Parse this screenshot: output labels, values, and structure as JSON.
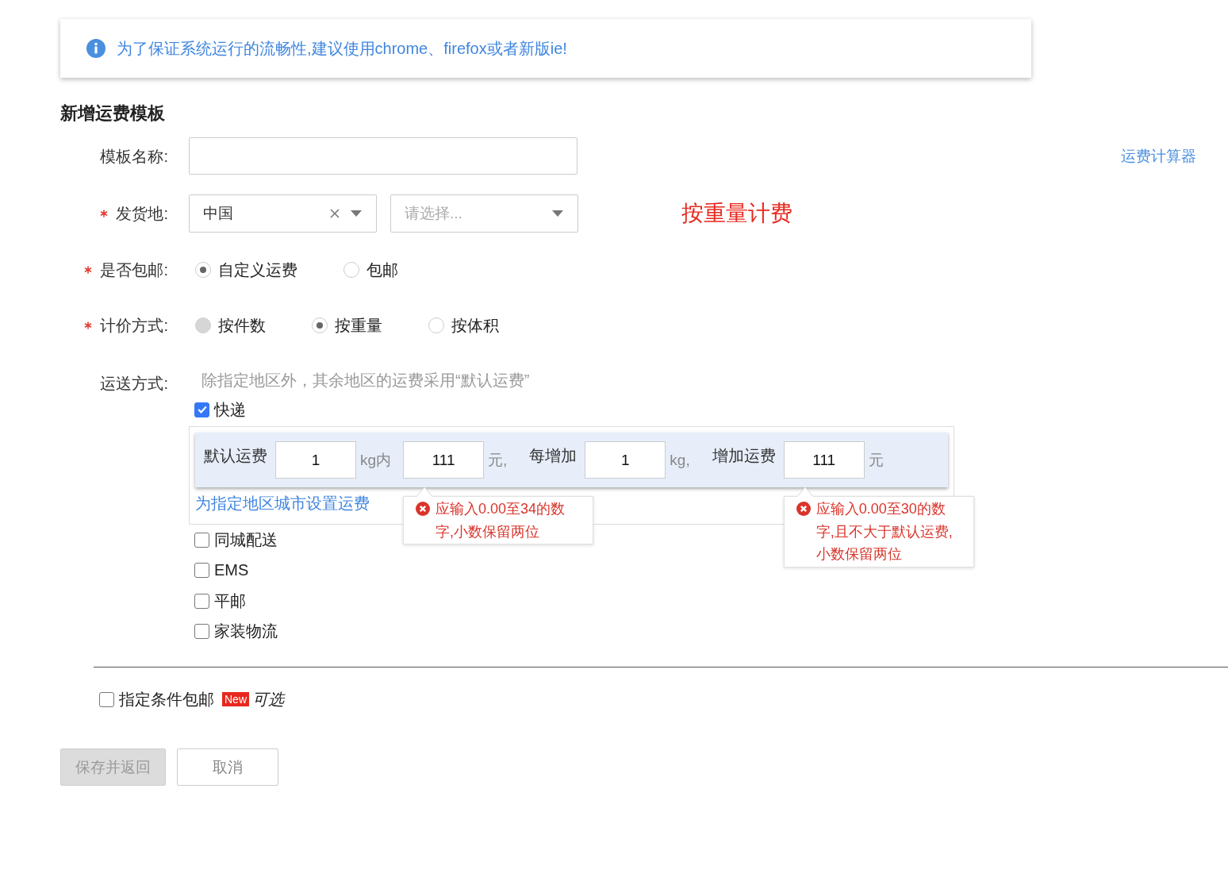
{
  "notice": {
    "text": "为了保证系统运行的流畅性,建议使用chrome、firefox或者新版ie!"
  },
  "form": {
    "title": "新增运费模板",
    "fields": [
      {
        "kind": "text",
        "label": "模板名称:",
        "required": false,
        "link": "运费计算器"
      },
      {
        "kind": "selects",
        "label": "发货地:",
        "required": true,
        "selects": [
          {
            "value": "中国",
            "clearable": true
          },
          {
            "placeholder": "请选择...",
            "clearable": false
          }
        ],
        "note": "按重量计费"
      },
      {
        "kind": "radios",
        "label": "是否包邮:",
        "required": true,
        "options": [
          {
            "label": "自定义运费",
            "selected": true,
            "disabled": false
          },
          {
            "label": "包邮",
            "selected": false,
            "disabled": false
          }
        ]
      },
      {
        "kind": "radios",
        "label": "计价方式:",
        "required": true,
        "options": [
          {
            "label": "按件数",
            "selected": false,
            "disabled": true
          },
          {
            "label": "按重量",
            "selected": true,
            "disabled": false
          },
          {
            "label": "按体积",
            "selected": false,
            "disabled": false
          }
        ]
      },
      {
        "kind": "shipping",
        "label": "运送方式:",
        "required": false,
        "hint": "除指定地区外，其余地区的运费采用“默认运费”",
        "methods": [
          {
            "label": "快递",
            "checked": true,
            "fee_row": [
              {
                "kind": "label",
                "text": "默认运费"
              },
              {
                "kind": "input",
                "value": "1"
              },
              {
                "kind": "unit",
                "text": "kg内"
              },
              {
                "kind": "input",
                "value": "111",
                "error": "应输入0.00至34的数字,小数保留两位"
              },
              {
                "kind": "unit",
                "text": "元,"
              },
              {
                "kind": "label",
                "text": "每增加"
              },
              {
                "kind": "input",
                "value": "1"
              },
              {
                "kind": "unit",
                "text": "kg,"
              },
              {
                "kind": "label",
                "text": "增加运费"
              },
              {
                "kind": "input",
                "value": "111",
                "error": "应输入0.00至30的数字,且不大于默认运费,小数保留两位"
              },
              {
                "kind": "unit",
                "text": "元"
              }
            ],
            "region_link": "为指定地区城市设置运费"
          },
          {
            "label": "同城配送",
            "checked": false
          },
          {
            "label": "EMS",
            "checked": false
          },
          {
            "label": "平邮",
            "checked": false
          },
          {
            "label": "家装物流",
            "checked": false
          }
        ]
      }
    ]
  },
  "free_shipping": {
    "label": "指定条件包邮",
    "checked": false,
    "badge": "New",
    "note": "可选"
  },
  "buttons": [
    {
      "kind": "submit",
      "label": "保存并返回",
      "disabled": true
    },
    {
      "kind": "cancel",
      "label": "取消",
      "disabled": false
    }
  ]
}
